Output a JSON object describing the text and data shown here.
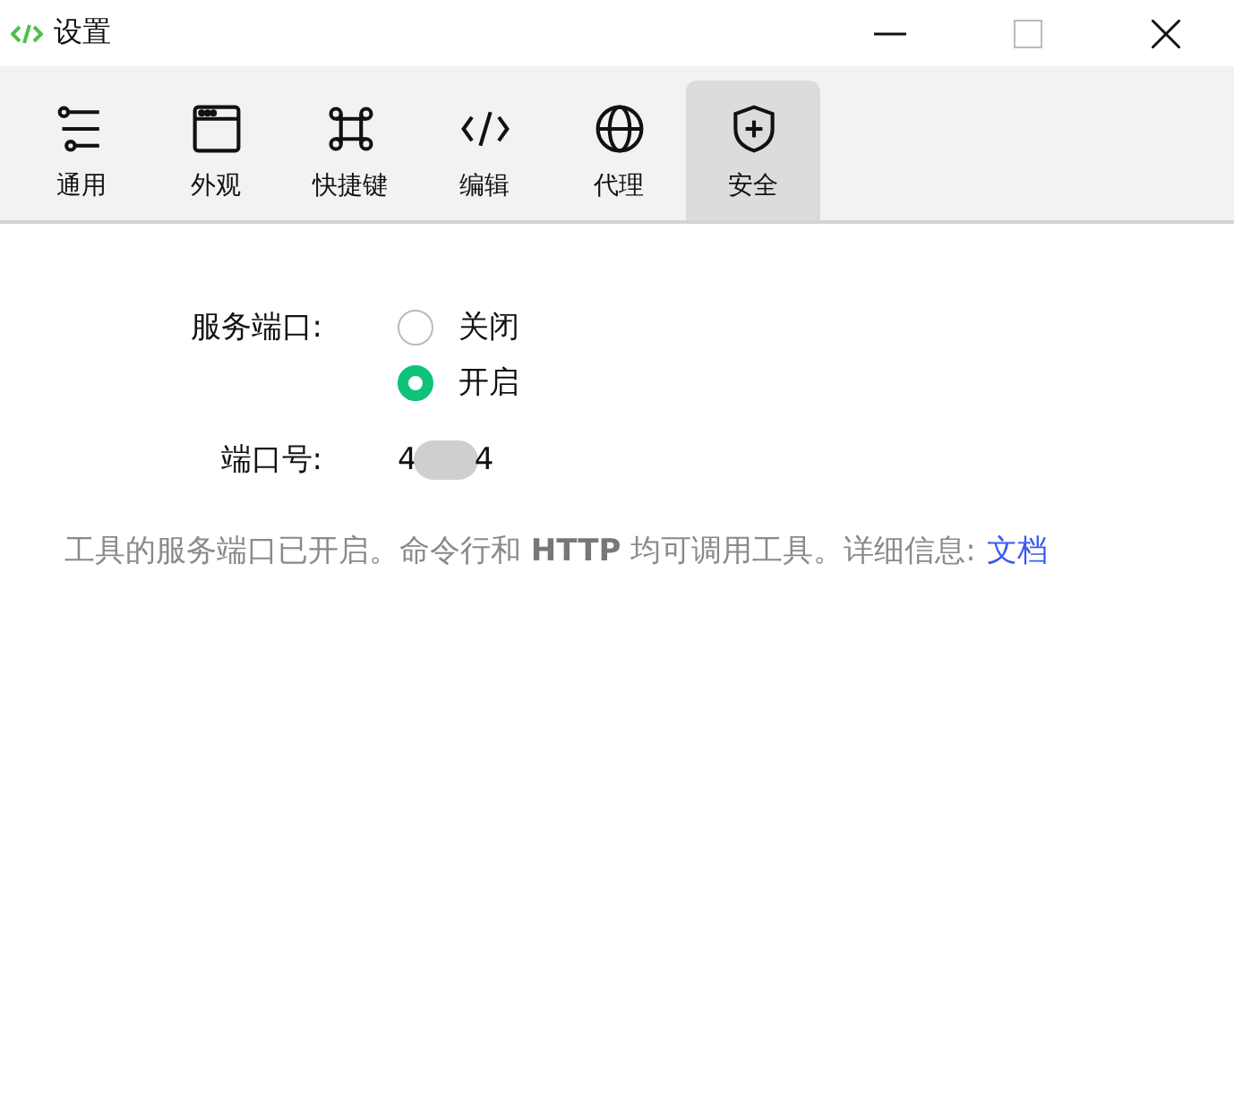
{
  "window": {
    "title": "设置"
  },
  "tabs": [
    {
      "label": "通用",
      "kind": "sliders",
      "selected": false
    },
    {
      "label": "外观",
      "kind": "window",
      "selected": false
    },
    {
      "label": "快捷键",
      "kind": "command",
      "selected": false
    },
    {
      "label": "编辑",
      "kind": "code",
      "selected": false
    },
    {
      "label": "代理",
      "kind": "globe",
      "selected": false
    },
    {
      "label": "安全",
      "kind": "shield",
      "selected": true
    }
  ],
  "service_port": {
    "label": "服务端口:",
    "options": [
      {
        "label": "关闭",
        "selected": false
      },
      {
        "label": "开启",
        "selected": true
      }
    ]
  },
  "port_number": {
    "label": "端口号:",
    "value_start": "4",
    "value_end": "4"
  },
  "info": {
    "text": "工具的服务端口已开启。命令行和 **HTTP** 均可调用工具。详细信息:",
    "link": "文档"
  }
}
